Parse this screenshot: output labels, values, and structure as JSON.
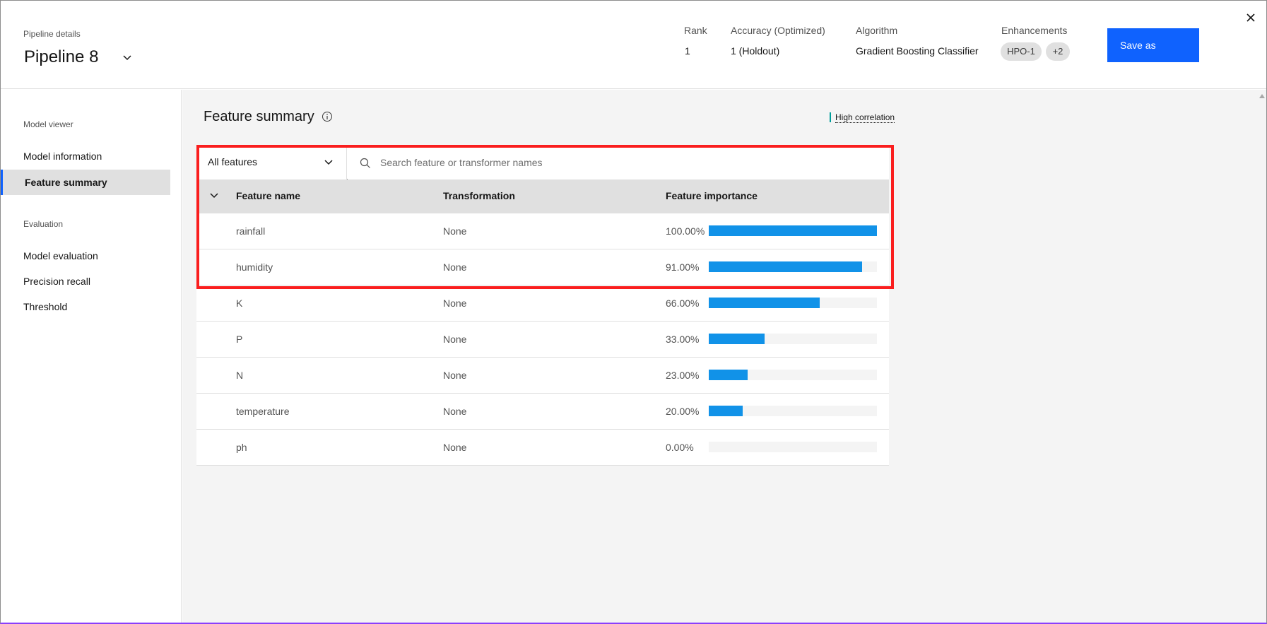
{
  "header": {
    "label": "Pipeline details",
    "title": "Pipeline 8",
    "rank": {
      "label": "Rank",
      "value": "1"
    },
    "accuracy": {
      "label": "Accuracy  (Optimized)",
      "value": "1 (Holdout)"
    },
    "algorithm": {
      "label": "Algorithm",
      "value": "Gradient Boosting Classifier"
    },
    "enhancements": {
      "label": "Enhancements",
      "tags": [
        "HPO-1",
        "+2"
      ]
    },
    "save_label": "Save as"
  },
  "sidebar": {
    "section1": "Model viewer",
    "items1": [
      "Model information",
      "Feature summary"
    ],
    "section2": "Evaluation",
    "items2": [
      "Model evaluation",
      "Precision recall",
      "Threshold"
    ],
    "active": "Feature summary"
  },
  "main": {
    "title": "Feature summary",
    "high_correlation": "High correlation",
    "filter": "All features",
    "search_placeholder": "Search feature or transformer names",
    "columns": [
      "Feature name",
      "Transformation",
      "Feature importance"
    ],
    "rows": [
      {
        "name": "rainfall",
        "transformation": "None",
        "importance": "100.00%",
        "fraction": 1.0
      },
      {
        "name": "humidity",
        "transformation": "None",
        "importance": "91.00%",
        "fraction": 0.91
      },
      {
        "name": "K",
        "transformation": "None",
        "importance": "66.00%",
        "fraction": 0.66
      },
      {
        "name": "P",
        "transformation": "None",
        "importance": "33.00%",
        "fraction": 0.33
      },
      {
        "name": "N",
        "transformation": "None",
        "importance": "23.00%",
        "fraction": 0.23
      },
      {
        "name": "temperature",
        "transformation": "None",
        "importance": "20.00%",
        "fraction": 0.2
      },
      {
        "name": "ph",
        "transformation": "None",
        "importance": "0.00%",
        "fraction": 0.0
      }
    ]
  },
  "colors": {
    "accent": "#0f62fe",
    "bar": "#1192e8",
    "highlight": "#fa1e1e",
    "correlation": "#009d9a"
  }
}
